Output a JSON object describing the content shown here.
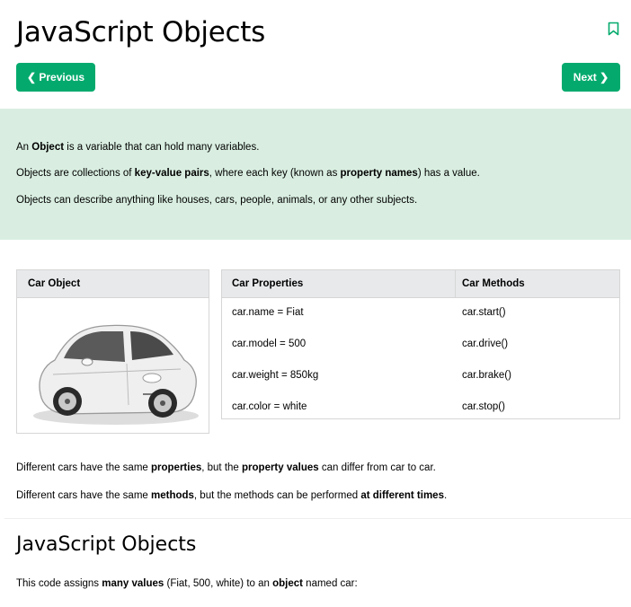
{
  "header": {
    "title": "JavaScript Objects",
    "prev_label": "❮ Previous",
    "next_label": "Next ❯",
    "bookmark_icon": "bookmark-icon"
  },
  "intro": {
    "line1": {
      "t1": "An ",
      "b1": "Object",
      "t2": " is a variable that can hold many variables."
    },
    "line2": {
      "t1": "Objects are collections of ",
      "b1": "key-value pairs",
      "t2": ", where each key (known as ",
      "b2": "property names",
      "t3": ") has a value."
    },
    "line3": "Objects can describe anything like houses, cars, people, animals, or any other subjects."
  },
  "car_card": {
    "header": "Car Object",
    "image": "white-fiat-car-image"
  },
  "properties_table": {
    "headers": [
      "Car Properties",
      "Car Methods"
    ],
    "rows": [
      [
        "car.name = Fiat",
        "car.start()"
      ],
      [
        "car.model = 500",
        "car.drive()"
      ],
      [
        "car.weight = 850kg",
        "car.brake()"
      ],
      [
        "car.color = white",
        "car.stop()"
      ]
    ]
  },
  "notes": {
    "line1": {
      "t1": "Different cars have the same ",
      "b1": "properties",
      "t2": ", but the ",
      "b2": "property values",
      "t3": " can differ from car to car."
    },
    "line2": {
      "t1": "Different cars have the same ",
      "b1": "methods",
      "t2": ", but the methods can be performed ",
      "b2": "at different times",
      "t3": "."
    }
  },
  "section2": {
    "title": "JavaScript Objects",
    "line": {
      "t1": "This code assigns ",
      "b1": "many values",
      "t2": " (Fiat, 500, white) to an ",
      "b2": "object",
      "t3": " named car:"
    }
  },
  "colors": {
    "accent": "#04aa6d",
    "intro_bg": "#d9eee1",
    "table_head_bg": "#e7e9eb"
  }
}
